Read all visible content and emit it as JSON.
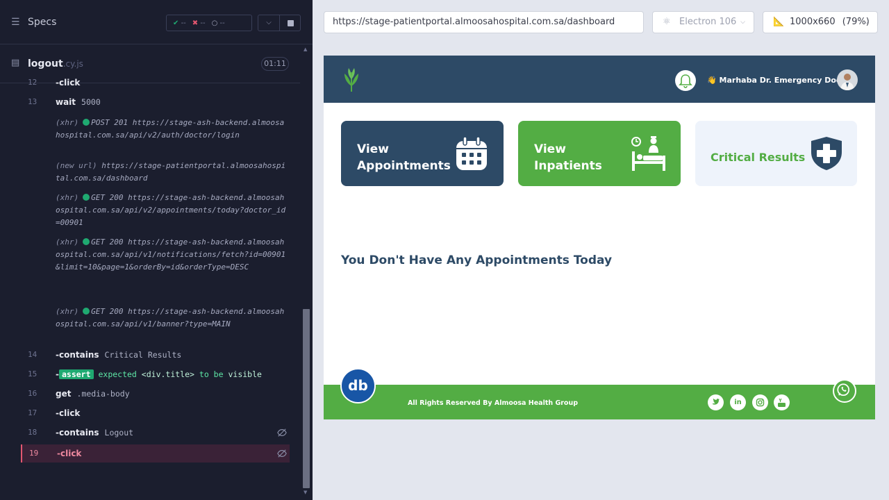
{
  "runner": {
    "specs_label": "Specs",
    "stats": {
      "passed": "--",
      "failed": "--",
      "pending": "--"
    },
    "file": {
      "name": "logout",
      "ext": ".cy.js",
      "duration": "01:11"
    },
    "commands": [
      {
        "num": "12",
        "name": "-click",
        "arg": ""
      },
      {
        "num": "13",
        "name": "wait",
        "arg": "5000"
      },
      {
        "type": "xhr",
        "tag": "(xhr)",
        "status": "POST 201",
        "url": "https://stage-ash-backend.almoosahospital.com.sa/api/v2/auth/doctor/login"
      },
      {
        "type": "newurl",
        "tag": "(new url)",
        "url": "https://stage-patientportal.almoosahospital.com.sa/dashboard"
      },
      {
        "type": "xhr",
        "tag": "(xhr)",
        "status": "GET 200",
        "url": "https://stage-ash-backend.almoosahospital.com.sa/api/v2/appointments/today?doctor_id=00901"
      },
      {
        "type": "xhr",
        "tag": "(xhr)",
        "status": "GET 200",
        "url": "https://stage-ash-backend.almoosahospital.com.sa/api/v1/notifications/fetch?id=00901&limit=10&page=1&orderBy=id&orderType=DESC"
      },
      {
        "type": "xhr",
        "tag": "(xhr)",
        "status": "GET 200",
        "url": "https://stage-ash-backend.almoosahospital.com.sa/api/v1/banner?type=MAIN"
      },
      {
        "num": "14",
        "name": "-contains",
        "arg": "Critical Results"
      },
      {
        "num": "15",
        "name": "-",
        "badge": "assert",
        "parts": [
          "expected",
          "<div.title>",
          "to be",
          "visible"
        ]
      },
      {
        "num": "16",
        "name": "get",
        "arg": ".media-body"
      },
      {
        "num": "17",
        "name": "-click",
        "arg": ""
      },
      {
        "num": "18",
        "name": "-contains",
        "arg": "Logout"
      },
      {
        "num": "19",
        "name": "-click",
        "arg": ""
      }
    ]
  },
  "browser": {
    "url": "https://stage-patientportal.almoosahospital.com.sa/dashboard",
    "browser_name": "Electron 106",
    "viewport": "1000x660",
    "zoom": "(79%)"
  },
  "app": {
    "greeting": "👋 Marhaba Dr. Emergency Doctor",
    "cards": [
      {
        "label": "View Appointments",
        "icon": "calendar-icon"
      },
      {
        "label": "View Inpatients",
        "icon": "hospital-bed-icon"
      },
      {
        "label": "Critical Results",
        "icon": "medical-shield-icon"
      }
    ],
    "empty_message": "You Don't Have Any Appointments Today",
    "footer": {
      "copyright": "All Rights Reserved By Almoosa Health Group",
      "social": [
        "twitter-icon",
        "linkedin-icon",
        "instagram-icon",
        "youtube-icon"
      ],
      "db_logo": "db"
    }
  },
  "colors": {
    "navy": "#2d4a66",
    "green": "#53ad44",
    "pass": "#1fa971",
    "fail": "#e45770"
  }
}
